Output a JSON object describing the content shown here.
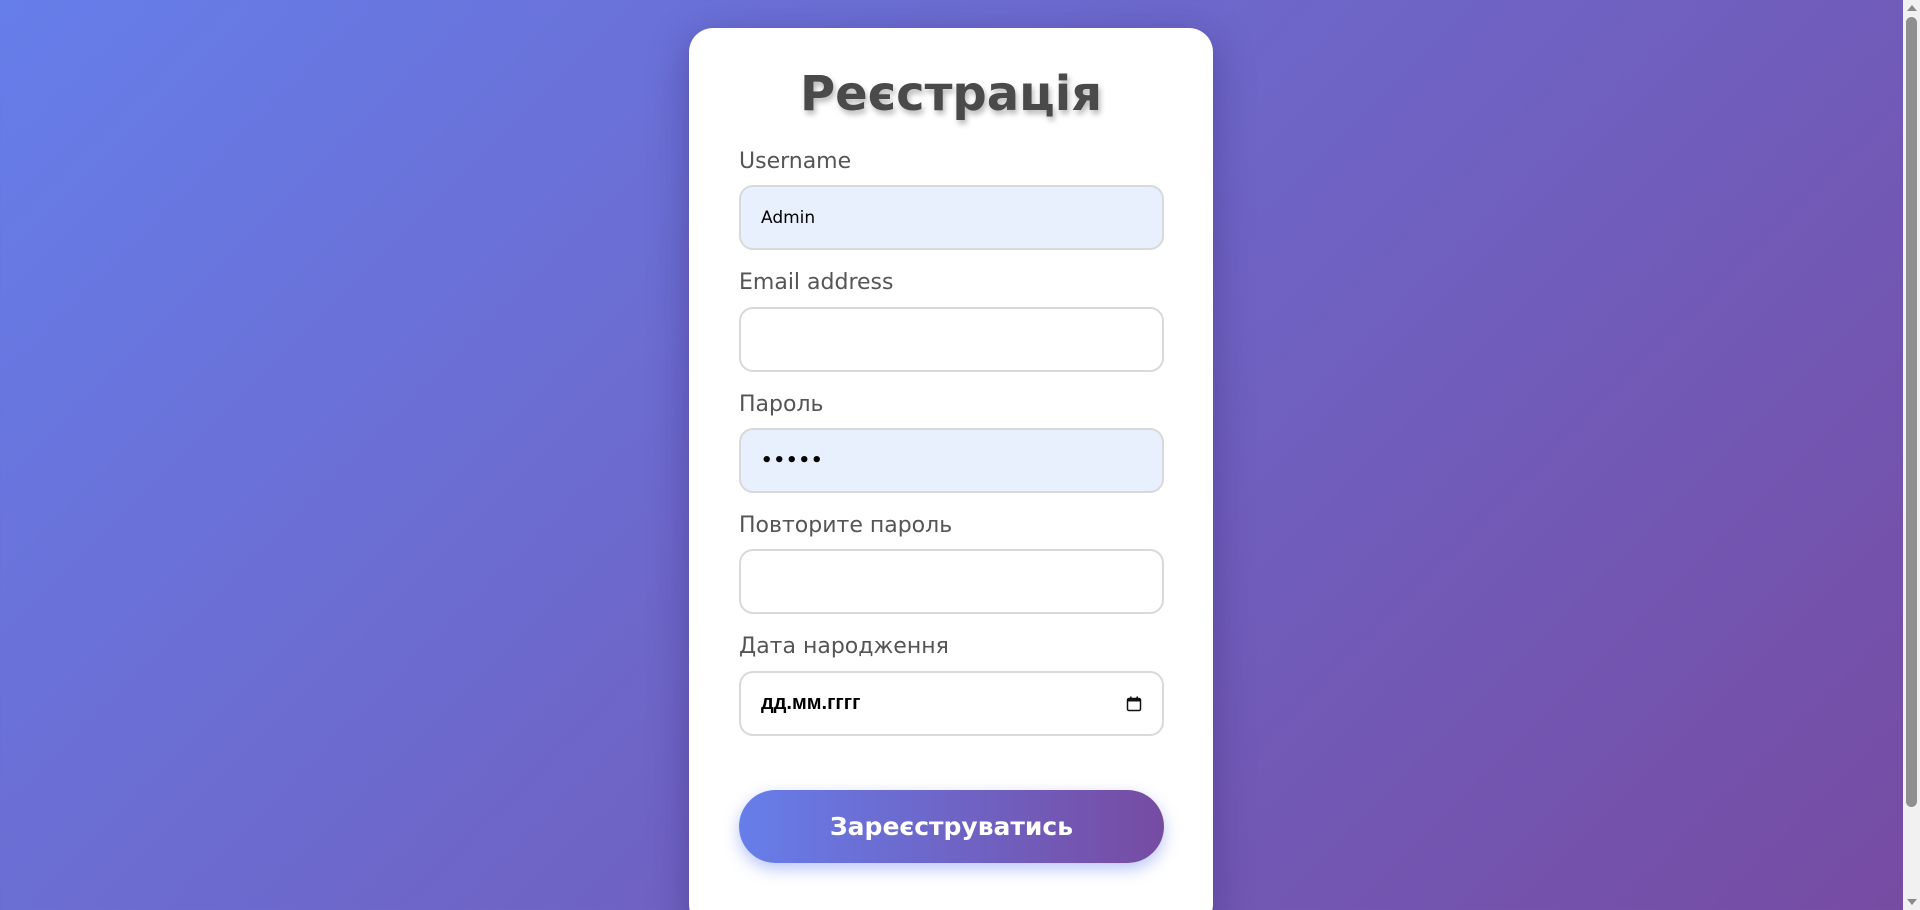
{
  "page": {
    "title": "Реєстрація"
  },
  "form": {
    "username": {
      "label": "Username",
      "value": "Admin"
    },
    "email": {
      "label": "Email address",
      "value": ""
    },
    "password": {
      "label": "Пароль",
      "value": "•••••"
    },
    "confirm_password": {
      "label": "Повторите пароль",
      "value": ""
    },
    "birth_date": {
      "label": "Дата народження",
      "placeholder": "дд.мм.гггг",
      "icon": "calendar-icon"
    },
    "submit_label": "Зареєструватись"
  },
  "colors": {
    "gradient_start": "#667eea",
    "gradient_end": "#764ba2",
    "autofill_bg": "#e8f0fe"
  }
}
